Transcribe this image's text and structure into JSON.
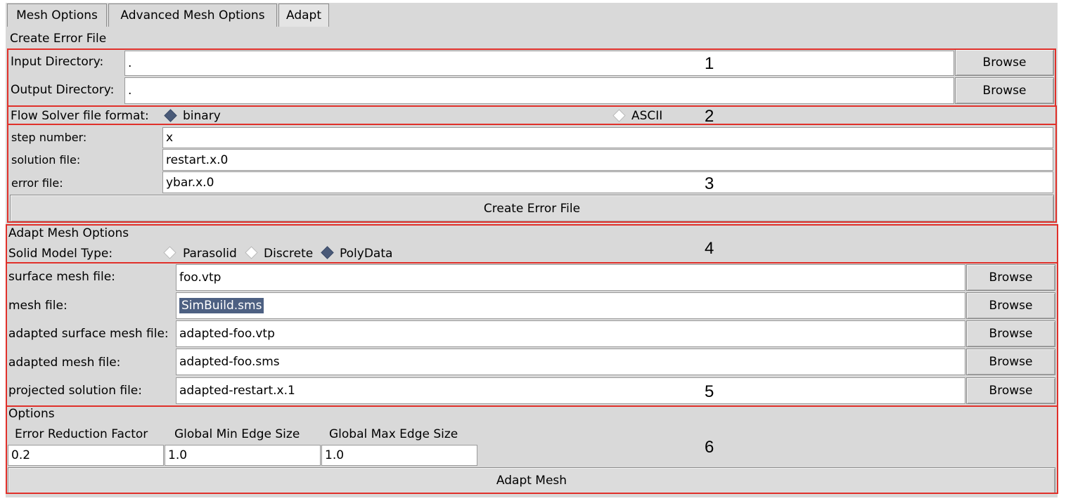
{
  "tabs": [
    {
      "label": "Mesh Options",
      "active": false
    },
    {
      "label": "Advanced Mesh Options",
      "active": false
    },
    {
      "label": "Adapt",
      "active": true
    }
  ],
  "create_error": {
    "section_title": "Create Error File",
    "input_dir": {
      "label": "Input Directory:",
      "value": ".",
      "button": "Browse"
    },
    "output_dir": {
      "label": "Output Directory:",
      "value": ".",
      "button": "Browse"
    },
    "format": {
      "label": "Flow Solver file format:",
      "options": [
        "binary",
        "ASCII"
      ],
      "selected": "binary"
    },
    "step_number": {
      "label": "step number:",
      "value": "x"
    },
    "solution_file": {
      "label": "solution file:",
      "value": "restart.x.0"
    },
    "error_file": {
      "label": "error file:",
      "value": "ybar.x.0"
    },
    "button": "Create Error File"
  },
  "adapt_mesh": {
    "section_title": "Adapt Mesh Options",
    "solid_model": {
      "label": "Solid Model Type:",
      "options": [
        "Parasolid",
        "Discrete",
        "PolyData"
      ],
      "selected": "PolyData"
    },
    "files": [
      {
        "label": "surface mesh file:",
        "value": "foo.vtp",
        "button": "Browse"
      },
      {
        "label": "mesh file:",
        "value": "SimBuild.sms",
        "button": "Browse"
      },
      {
        "label": "adapted surface mesh file:",
        "value": "adapted-foo.vtp",
        "button": "Browse"
      },
      {
        "label": "adapted mesh file:",
        "value": "adapted-foo.sms",
        "button": "Browse"
      },
      {
        "label": "projected solution file:",
        "value": "adapted-restart.x.1",
        "button": "Browse"
      }
    ]
  },
  "options": {
    "section_title": "Options",
    "error_reduction": {
      "label": "Error Reduction Factor",
      "value": "0.2"
    },
    "global_min": {
      "label": "Global Min Edge Size",
      "value": "1.0"
    },
    "global_max": {
      "label": "Global Max Edge Size",
      "value": "1.0"
    },
    "button": "Adapt Mesh"
  },
  "annotations": [
    "1",
    "2",
    "3",
    "4",
    "5",
    "6"
  ],
  "colors": {
    "annotation_border": "#e0302a",
    "panel": "#d9d9d9",
    "radio_selected": "#4a5a78",
    "selection": "#4d6082"
  }
}
